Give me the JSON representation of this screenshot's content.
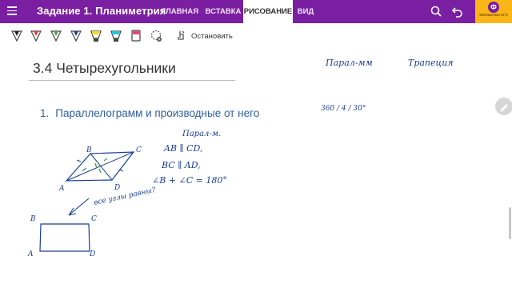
{
  "app": {
    "title": "Задание 1. Планиметрия",
    "tabs": [
      {
        "label": "ГЛАВНАЯ",
        "active": false
      },
      {
        "label": "ВСТАВКА",
        "active": false
      },
      {
        "label": "РИСОВАНИЕ",
        "active": true
      },
      {
        "label": "ВИД",
        "active": false
      }
    ],
    "logo_letter": "Ф",
    "logo_caption": "Математика ЕГЭ"
  },
  "colors": {
    "brand_purple": "#7b1fa2",
    "logo_yellow": "#f9b616",
    "ink_blue": "#1a3f94",
    "outline_blue": "#2e5fa0"
  },
  "toolbar": {
    "tools": [
      {
        "name": "pen-black-icon",
        "color": "#222222"
      },
      {
        "name": "pen-red-icon",
        "color": "#e53935"
      },
      {
        "name": "pen-green-icon",
        "color": "#43a047"
      },
      {
        "name": "pen-blue-icon",
        "color": "#1a3f94"
      },
      {
        "name": "highlighter-yellow-icon",
        "color": "#fdd835"
      },
      {
        "name": "highlighter-cyan-icon",
        "color": "#26c6da"
      },
      {
        "name": "highlighter-pink-icon",
        "color": "#ec407a"
      },
      {
        "name": "lasso-icon",
        "color": "#555555"
      }
    ],
    "stop_label": "Остановить"
  },
  "page": {
    "title": "3.4 Четырехугольники",
    "outline_number": "1.",
    "outline_text": "Параллелограмм и производные от него"
  },
  "handwriting": {
    "top_right_1": "Парал-мм",
    "top_right_2": "Трапеция",
    "fraction": "360 / 4 / 30°",
    "parallelogram_label": "Парал-м.",
    "line_1": "AB ∥ CD,",
    "line_2": "BC ∥ AD,",
    "line_3": "∠B + ∠C = 180°",
    "question": "все углы равны?",
    "para_vertices": [
      "B",
      "C",
      "A",
      "D"
    ],
    "rect_vertices": [
      "B",
      "C",
      "A",
      "D"
    ]
  }
}
